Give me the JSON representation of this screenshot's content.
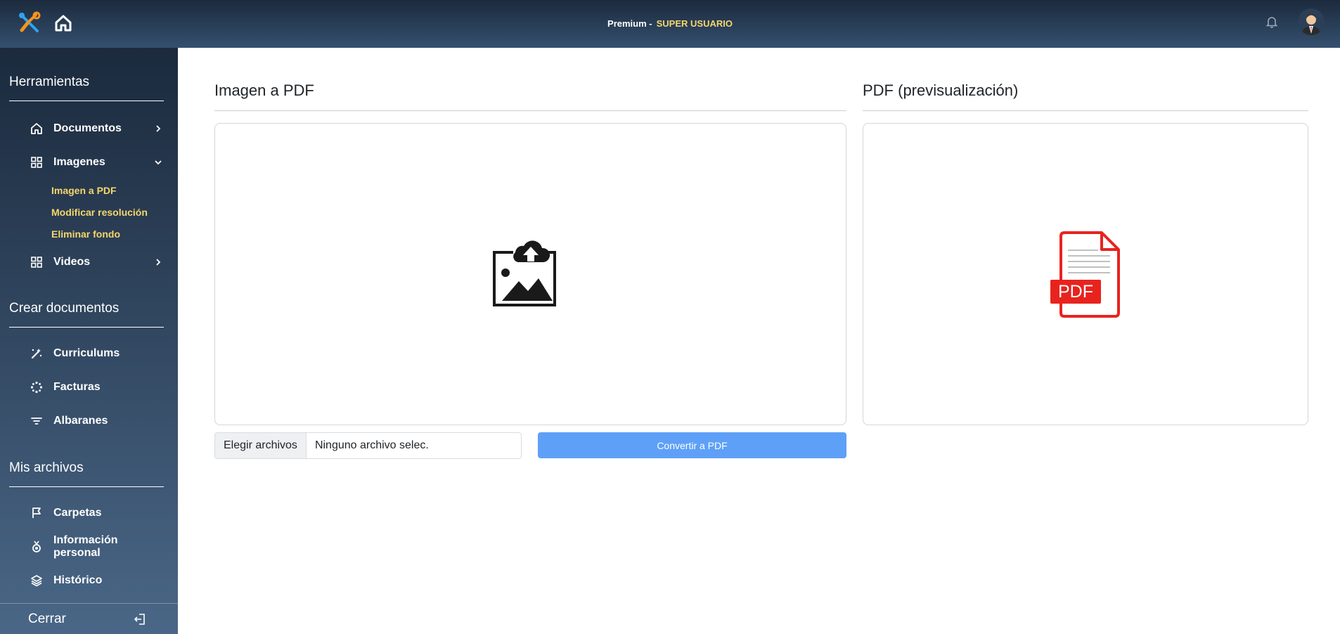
{
  "header": {
    "plan_label": "Premium -",
    "role_label": "SUPER USUARIO",
    "icons": [
      "tools-icon",
      "home-icon",
      "bell-icon",
      "avatar"
    ]
  },
  "sidebar": {
    "sections": [
      {
        "title": "Herramientas"
      },
      {
        "title": "Crear documentos"
      },
      {
        "title": "Mis archivos"
      }
    ],
    "items": {
      "documentos": "Documentos",
      "imagenes": "Imagenes",
      "videos": "Videos",
      "curriculums": "Curriculums",
      "facturas": "Facturas",
      "albaranes": "Albaranes",
      "carpetas": "Carpetas",
      "informacion": "Información personal",
      "historico": "Histórico"
    },
    "subitems": [
      "Imagen a PDF",
      "Modificar resolución",
      "Eliminar fondo"
    ],
    "logout_label": "Cerrar"
  },
  "main": {
    "left_title": "Imagen a PDF",
    "right_title": "PDF (previsualización)",
    "file_button_label": "Elegir archivos",
    "file_status": "Ninguno archivo selec.",
    "convert_label": "Convertir a PDF",
    "pdf_badge": "PDF"
  },
  "colors": {
    "accent": "#f6d66b",
    "button": "#5ea0f7",
    "pdf_red": "#e8231e",
    "tools_orange": "#f7941d",
    "tools_blue": "#2ea3f2"
  }
}
